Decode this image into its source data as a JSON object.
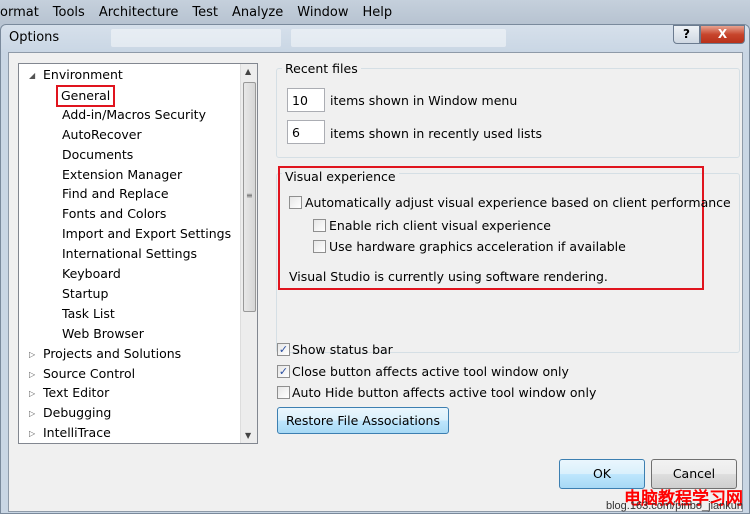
{
  "menubar": [
    "ormat",
    "Tools",
    "Architecture",
    "Test",
    "Analyze",
    "Window",
    "Help"
  ],
  "dialog": {
    "title": "Options",
    "help_label": "?",
    "close_label": "X"
  },
  "tree": {
    "items": [
      {
        "label": "Environment",
        "level": 0,
        "expanded": true
      },
      {
        "label": "General",
        "level": 1,
        "selected": true
      },
      {
        "label": "Add-in/Macros Security",
        "level": 1
      },
      {
        "label": "AutoRecover",
        "level": 1
      },
      {
        "label": "Documents",
        "level": 1
      },
      {
        "label": "Extension Manager",
        "level": 1
      },
      {
        "label": "Find and Replace",
        "level": 1
      },
      {
        "label": "Fonts and Colors",
        "level": 1
      },
      {
        "label": "Import and Export Settings",
        "level": 1
      },
      {
        "label": "International Settings",
        "level": 1
      },
      {
        "label": "Keyboard",
        "level": 1
      },
      {
        "label": "Startup",
        "level": 1
      },
      {
        "label": "Task List",
        "level": 1
      },
      {
        "label": "Web Browser",
        "level": 1
      },
      {
        "label": "Projects and Solutions",
        "level": 0
      },
      {
        "label": "Source Control",
        "level": 0
      },
      {
        "label": "Text Editor",
        "level": 0
      },
      {
        "label": "Debugging",
        "level": 0
      },
      {
        "label": "IntelliTrace",
        "level": 0
      }
    ]
  },
  "recent_files": {
    "title": "Recent files",
    "window_menu_count": "10",
    "window_menu_label": "items shown in Window menu",
    "recent_lists_count": "6",
    "recent_lists_label": "items shown in recently used lists"
  },
  "visual_experience": {
    "title": "Visual experience",
    "auto_adjust": {
      "label": "Automatically adjust visual experience based on client performance",
      "checked": false
    },
    "rich_client": {
      "label": "Enable rich client visual experience",
      "checked": false
    },
    "hw_accel": {
      "label": "Use hardware graphics acceleration if available",
      "checked": false
    },
    "status": "Visual Studio is currently using software rendering."
  },
  "options": [
    {
      "label": "Show status bar",
      "checked": true
    },
    {
      "label": "Close button affects active tool window only",
      "checked": true
    },
    {
      "label": "Auto Hide button affects active tool window only",
      "checked": false
    }
  ],
  "buttons": {
    "restore": "Restore File Associations",
    "ok": "OK",
    "cancel": "Cancel"
  },
  "watermark": {
    "text": "电脑教程学习网",
    "url": "blog.163.com/pinbo_jiankun"
  },
  "colors": {
    "highlight": "#e0141e"
  }
}
